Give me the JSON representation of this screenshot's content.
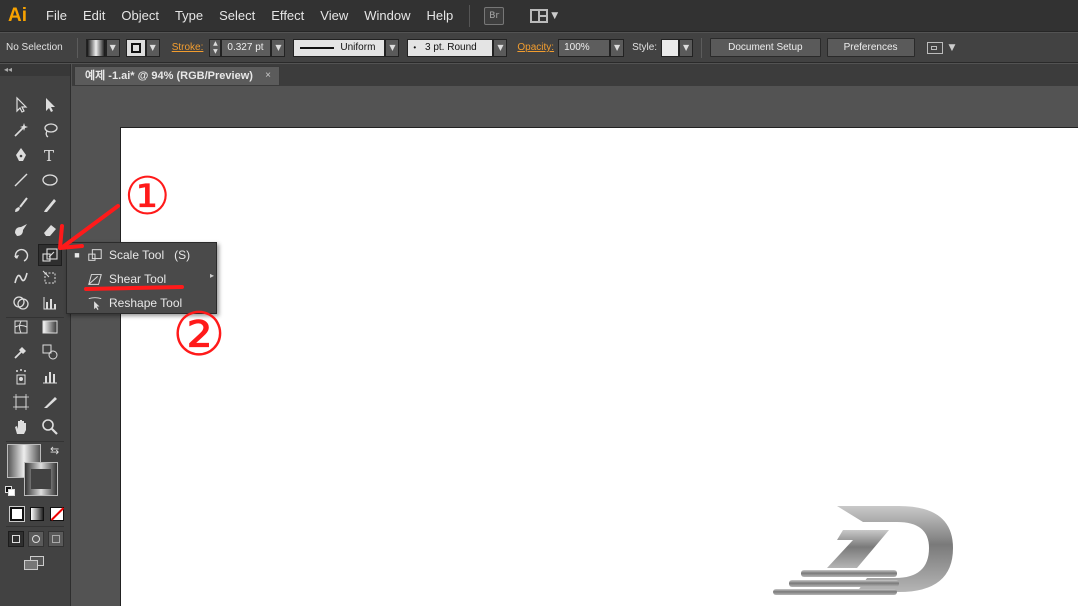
{
  "app": {
    "logo": "Ai",
    "menu": [
      "File",
      "Edit",
      "Object",
      "Type",
      "Select",
      "Effect",
      "View",
      "Window",
      "Help"
    ],
    "bridge_button": "Br"
  },
  "controlbar": {
    "selection_status": "No Selection",
    "stroke_label": "Stroke:",
    "stroke_value": "0.327 pt",
    "profile_value": "Uniform",
    "brush_value": "3 pt. Round",
    "opacity_label": "Opacity:",
    "opacity_value": "100%",
    "style_label": "Style:",
    "document_setup_button": "Document Setup",
    "preferences_button": "Preferences"
  },
  "document": {
    "tab_title": "예제 -1.ai* @ 94% (RGB/Preview)",
    "tab_close": "×"
  },
  "flyout": {
    "items": [
      {
        "label": "Scale Tool",
        "shortcut": "(S)",
        "icon": "scale-icon",
        "selected": true
      },
      {
        "label": "Shear Tool",
        "shortcut": "",
        "icon": "shear-icon",
        "selected": false
      },
      {
        "label": "Reshape Tool",
        "shortcut": "",
        "icon": "reshape-icon",
        "selected": false
      }
    ]
  },
  "annotations": {
    "marker_1": "①",
    "marker_2": "②",
    "color": "#ff1a1a"
  },
  "colors": {
    "accent_orange": "#f29d2f",
    "logo_orange": "#f7a200"
  }
}
